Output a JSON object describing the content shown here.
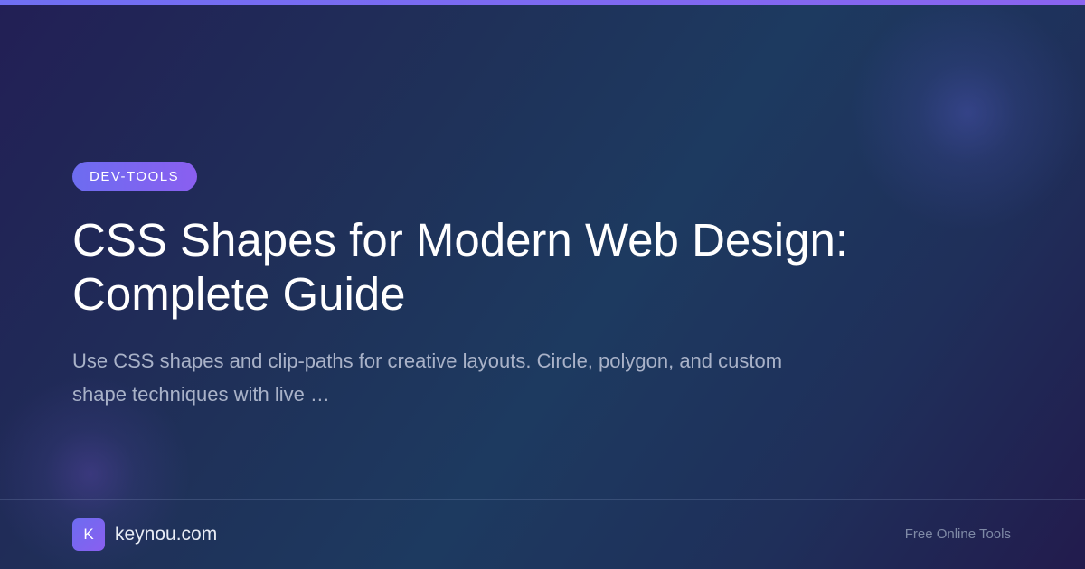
{
  "category": "DEV-TOOLS",
  "title": "CSS Shapes for Modern Web Design: Complete Guide",
  "description": "Use CSS shapes and clip-paths for creative layouts. Circle, polygon, and custom shape techniques with live …",
  "footer": {
    "logo_letter": "K",
    "site": "keynou.com",
    "tagline": "Free Online Tools"
  },
  "colors": {
    "accent": "#7b66f0",
    "background": "#1f3159"
  }
}
